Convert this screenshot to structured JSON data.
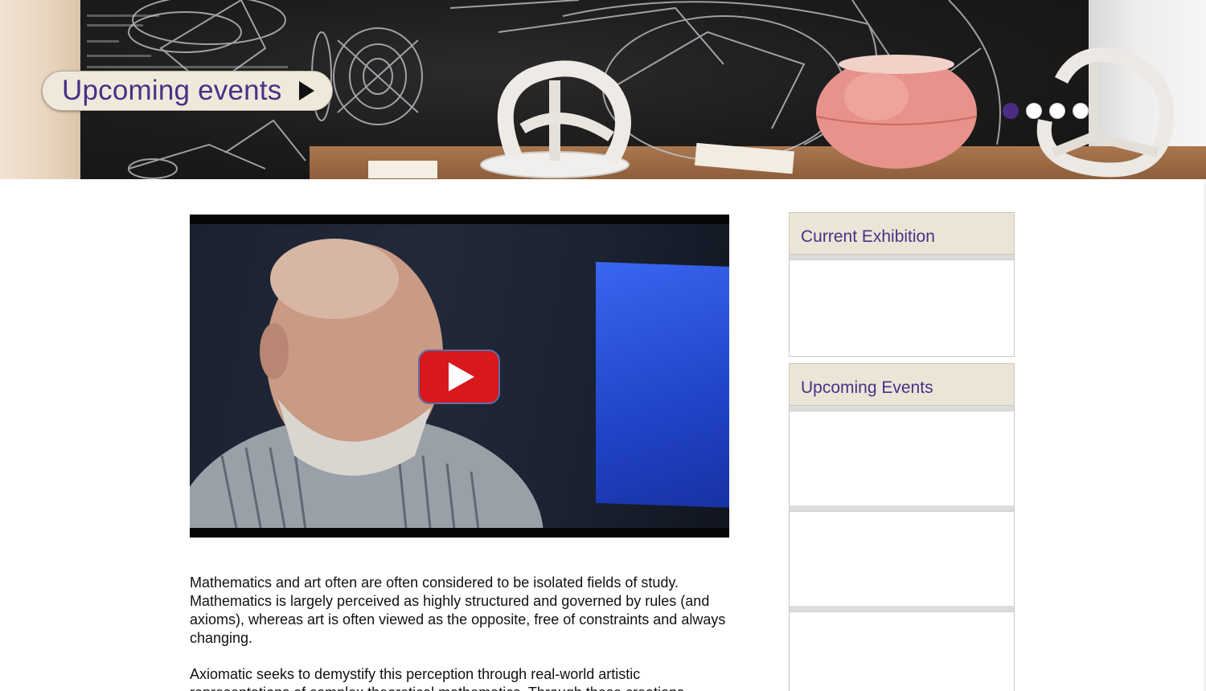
{
  "hero": {
    "cta_label": "Upcoming events",
    "slides": [
      {
        "active": true
      },
      {
        "active": false
      },
      {
        "active": false
      },
      {
        "active": false
      }
    ],
    "accent_color": "#4a2c85"
  },
  "video": {
    "play_icon": "play-icon",
    "play_color": "#d8181c"
  },
  "article": {
    "paragraphs": [
      "Mathematics and art often are often considered to be isolated fields of study. Mathematics is largely perceived as highly structured and governed by rules (and axioms), whereas art is often viewed as the opposite, free of constraints and always changing.",
      "Axiomatic seeks to demystify this perception through real-world artistic representations of complex theoretical mathematics. Through these creations"
    ]
  },
  "sidebar": {
    "current_exhibition_title": "Current Exhibition",
    "upcoming_events_title": "Upcoming Events",
    "heading_color": "#4b2f86"
  }
}
